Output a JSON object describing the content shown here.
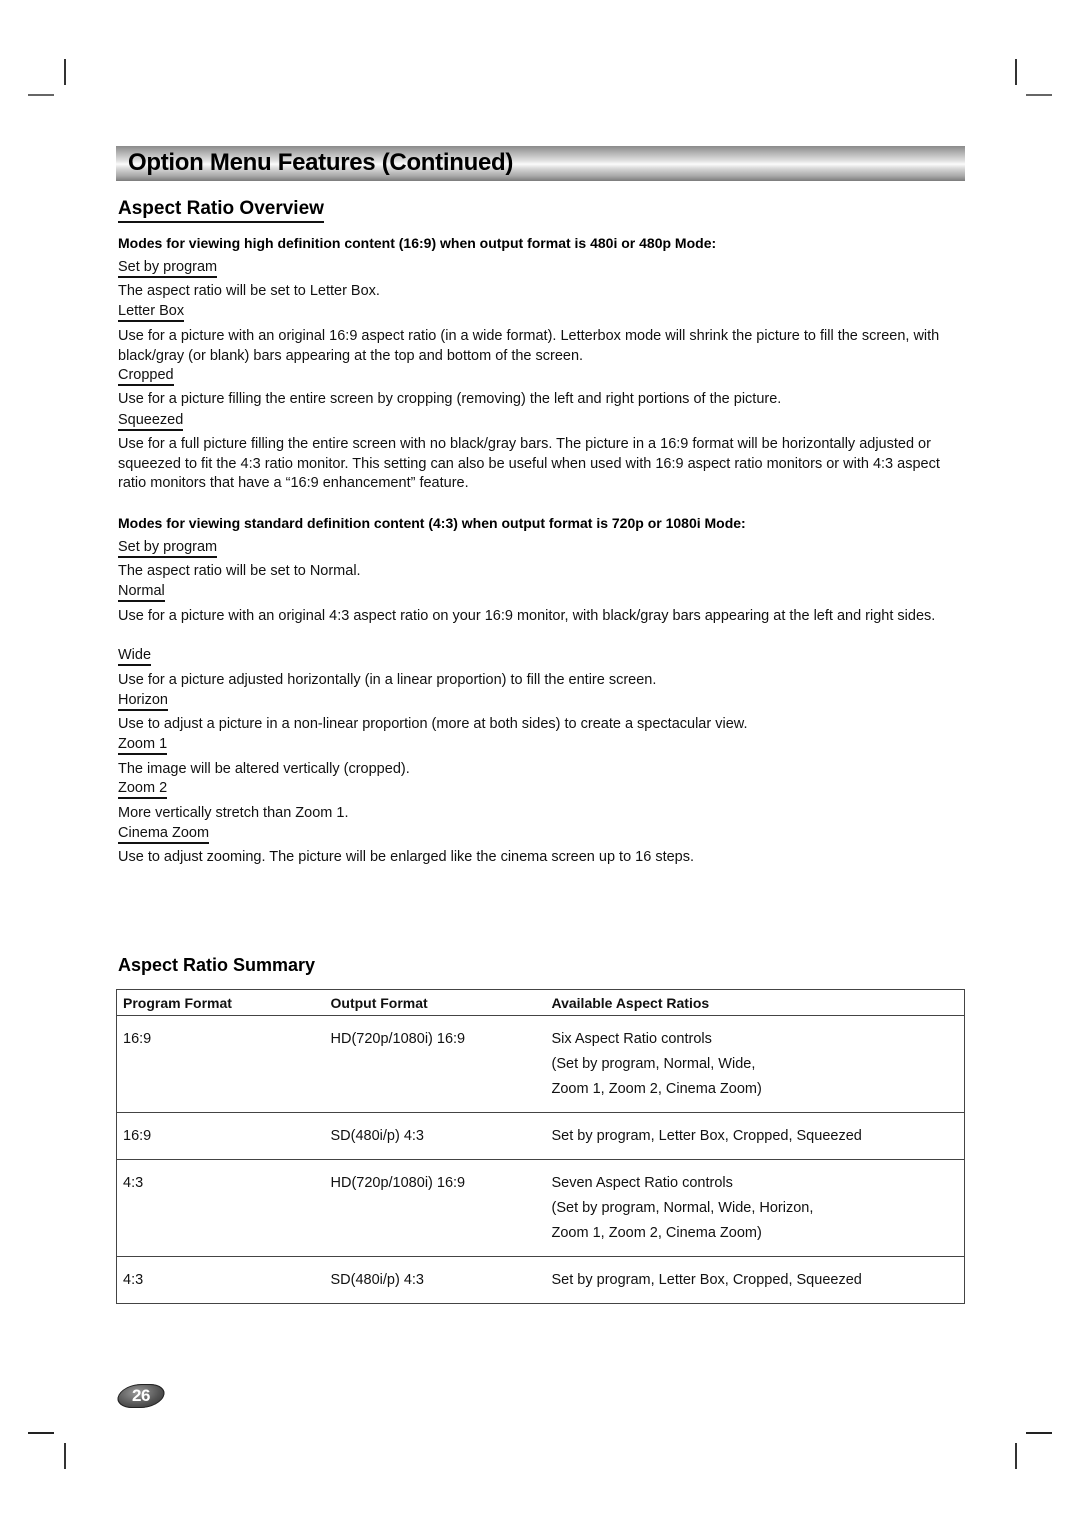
{
  "page": {
    "section_title": "Option Menu Features (Continued)",
    "page_number": "26"
  },
  "overview": {
    "heading": "Aspect Ratio Overview",
    "hd_group": {
      "heading": "Modes for viewing high definition content (16:9) when output format is 480i or 480p Mode:",
      "items": [
        {
          "term": "Set by program",
          "description": "The aspect ratio will be set to Letter Box."
        },
        {
          "term": "Letter Box",
          "description": "Use for a picture with an original 16:9 aspect ratio (in a wide format).  Letterbox mode will shrink the picture to fill the screen, with black/gray (or blank) bars appearing at the top and bottom of the screen."
        },
        {
          "term": "Cropped",
          "description": "Use for a picture filling the entire screen by cropping (removing) the left and right portions of the picture."
        },
        {
          "term": "Squeezed",
          "description": "Use for a full picture filling the entire screen with no black/gray bars.  The picture in a 16:9 format will be horizontally adjusted or squeezed to fit the 4:3 ratio monitor.  This setting can also be useful when used with 16:9 aspect ratio monitors or with 4:3 aspect ratio monitors that have a “16:9 enhancement” feature."
        }
      ]
    },
    "sd_group": {
      "heading": "Modes for viewing standard definition content (4:3) when output format is 720p or 1080i Mode:",
      "items": [
        {
          "term": "Set by program",
          "description": "The aspect ratio will be set to Normal."
        },
        {
          "term": "Normal",
          "description": "Use for a picture with an original 4:3 aspect ratio on your 16:9 monitor, with black/gray bars appearing at the left and right sides."
        },
        {
          "term": "Wide",
          "description": "Use for a picture adjusted horizontally (in a linear proportion) to fill the entire screen."
        },
        {
          "term": "Horizon",
          "description": "Use to adjust a picture in a non-linear proportion (more at both sides) to create a spectacular view."
        },
        {
          "term": "Zoom 1",
          "description": "The image will be altered vertically (cropped)."
        },
        {
          "term": "Zoom 2",
          "description": "More vertically stretch than Zoom 1."
        },
        {
          "term": "Cinema Zoom",
          "description": "Use to adjust zooming. The picture will be enlarged like the cinema screen up to 16 steps."
        }
      ]
    }
  },
  "summary": {
    "heading": "Aspect Ratio Summary",
    "columns": [
      "Program Format",
      "Output Format",
      "Available Aspect Ratios"
    ],
    "rows": [
      {
        "program": "16:9",
        "output": "HD(720p/1080i) 16:9",
        "ratios": [
          "Six Aspect Ratio controls",
          "(Set by program, Normal, Wide,",
          "Zoom 1, Zoom 2, Cinema Zoom)"
        ]
      },
      {
        "program": "16:9",
        "output": "SD(480i/p) 4:3",
        "ratios": [
          "Set by program, Letter Box, Cropped, Squeezed"
        ]
      },
      {
        "program": "4:3",
        "output": "HD(720p/1080i) 16:9",
        "ratios": [
          "Seven Aspect Ratio controls",
          "(Set by program, Normal, Wide, Horizon,",
          "Zoom 1, Zoom 2, Cinema Zoom)"
        ]
      },
      {
        "program": "4:3",
        "output": "SD(480i/p) 4:3",
        "ratios": [
          "Set by program, Letter Box, Cropped, Squeezed"
        ]
      }
    ]
  }
}
